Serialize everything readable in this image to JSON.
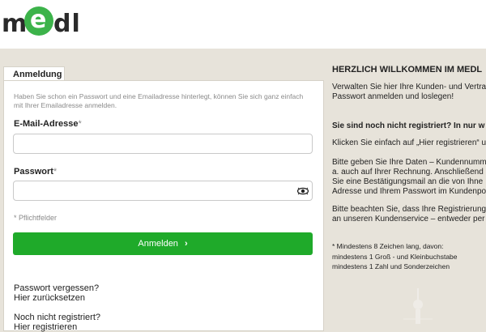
{
  "logo": {
    "text_m": "m",
    "text_e": "e",
    "text_dl": "dl",
    "brand_color": "#3cb34a"
  },
  "tab": {
    "label": "Anmeldung"
  },
  "form": {
    "intro": "Haben Sie schon ein Passwort und eine Emailadresse hinterlegt, können Sie sich ganz einfach mit Ihrer Emailadresse anmelden.",
    "email_label": "E-Mail-Adresse",
    "email_required": "*",
    "email_value": "",
    "password_label": "Passwort",
    "password_required": "*",
    "password_value": "",
    "required_note": "* Pflichtfelder",
    "login_button": "Anmelden",
    "login_chevron": "›",
    "forgot_line1": "Passwort vergessen?",
    "forgot_line2": "Hier zurücksetzen",
    "register_line1": "Noch nicht registriert?",
    "register_line2": "Hier registrieren",
    "button_color": "#1faa2a"
  },
  "info": {
    "title": "HERZLICH WILLKOMMEN IM MEDL",
    "p1_line1": "Verwalten Sie hier Ihre Kunden- und Vertra",
    "p1_line2": "Passwort anmelden und loslegen!",
    "question": "Sie sind noch nicht registriert? In nur w",
    "p2": "Klicken Sie einfach auf „Hier registrieren“ u",
    "p3_line1": "Bitte geben Sie Ihre Daten – Kundennumm",
    "p3_line2": "a. auch auf Ihrer Rechnung. Anschließend",
    "p3_line3": "Sie eine Bestätigungsmail an die von Ihne",
    "p3_line4": "Adresse und Ihrem Passwort im Kundenpo",
    "p4_line1": "Bitte beachten Sie, dass Ihre Registrierung",
    "p4_line2": "an unseren Kundenservice – entweder per",
    "note_line1": "* Mindestens 8 Zeichen lang, davon:",
    "note_line2": "mindestens 1 Groß - und Kleinbuchstabe",
    "note_line3": "mindestens 1 Zahl und Sonderzeichen"
  }
}
